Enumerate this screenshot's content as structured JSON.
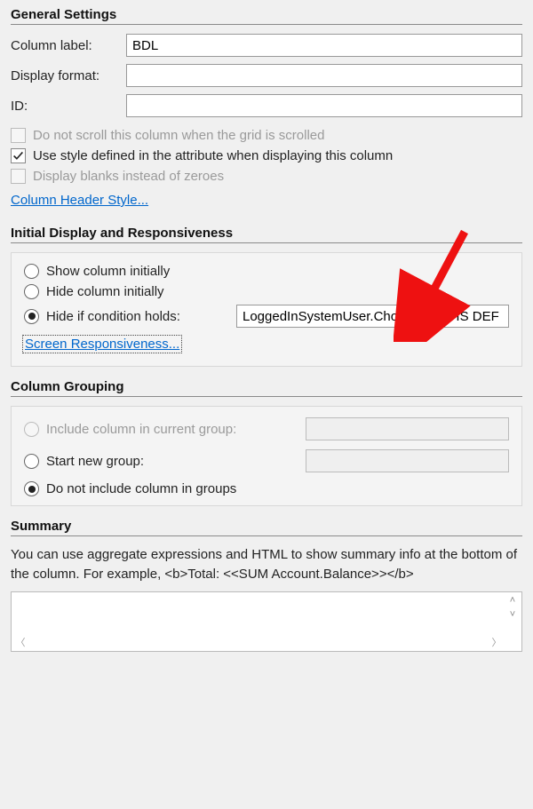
{
  "sections": {
    "general": {
      "title": "General Settings",
      "column_label_lbl": "Column label:",
      "column_label_val": "BDL",
      "display_format_lbl": "Display format:",
      "display_format_val": "",
      "id_lbl": "ID:",
      "id_val": "",
      "chk_noscroll": "Do not scroll this column when the grid is scrolled",
      "chk_usestyle": "Use style defined in the attribute when displaying this column",
      "chk_blanks": "Display blanks instead of zeroes",
      "link_header_style": "Column Header Style..."
    },
    "initial": {
      "title": "Initial Display and Responsiveness",
      "r_show": "Show column initially",
      "r_hide": "Hide column initially",
      "r_cond": "Hide if condition holds:",
      "cond_val": "LoggedInSystemUser.Chosen_BDL IS DEF",
      "link_resp": "Screen Responsiveness..."
    },
    "grouping": {
      "title": "Column Grouping",
      "r_include": "Include column in current group:",
      "r_startnew": "Start new group:",
      "r_donot": "Do not include column in groups"
    },
    "summary": {
      "title": "Summary",
      "desc": "You can use aggregate expressions and HTML to show summary info at the bottom of the column. For example,  <b>Total: <<SUM Account.Balance>></b>",
      "val": ""
    }
  }
}
